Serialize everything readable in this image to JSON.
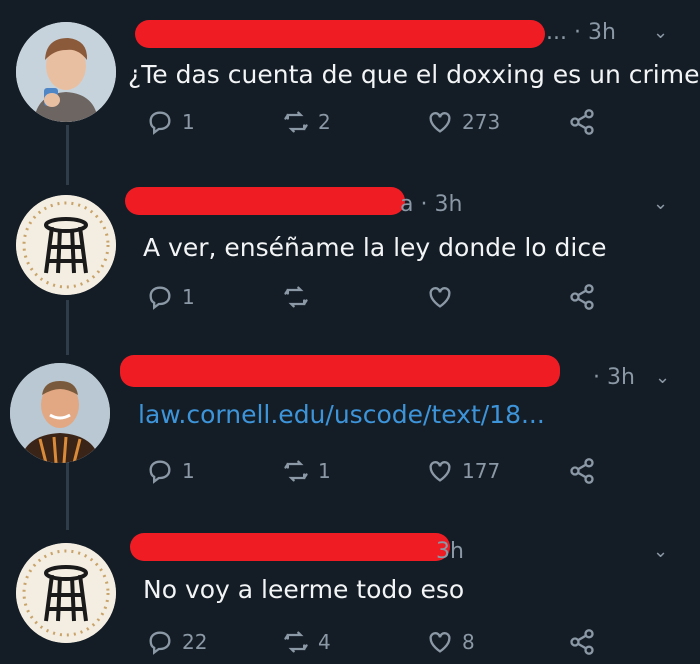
{
  "tweets": [
    {
      "meta": "... · 3h",
      "text": "¿Te das cuenta de que el doxxing es un crimen?",
      "replies": "1",
      "retweets": "2",
      "likes": "273"
    },
    {
      "meta": "a · 3h",
      "text": "A ver, enséñame la ley donde lo dice",
      "replies": "1",
      "retweets": "",
      "likes": ""
    },
    {
      "meta": "· 3h",
      "text": "law.cornell.edu/uscode/text/18...",
      "replies": "1",
      "retweets": "1",
      "likes": "177"
    },
    {
      "meta": "3h",
      "text": "No voy a leerme todo eso",
      "replies": "22",
      "retweets": "4",
      "likes": "8"
    }
  ],
  "colors": {
    "background": "#141d26",
    "redaction": "#f01c24",
    "link": "#3d94d9",
    "muted": "#8b98a5"
  },
  "icons": [
    "reply-icon",
    "retweet-icon",
    "like-icon",
    "share-icon",
    "chevron-down-icon"
  ]
}
